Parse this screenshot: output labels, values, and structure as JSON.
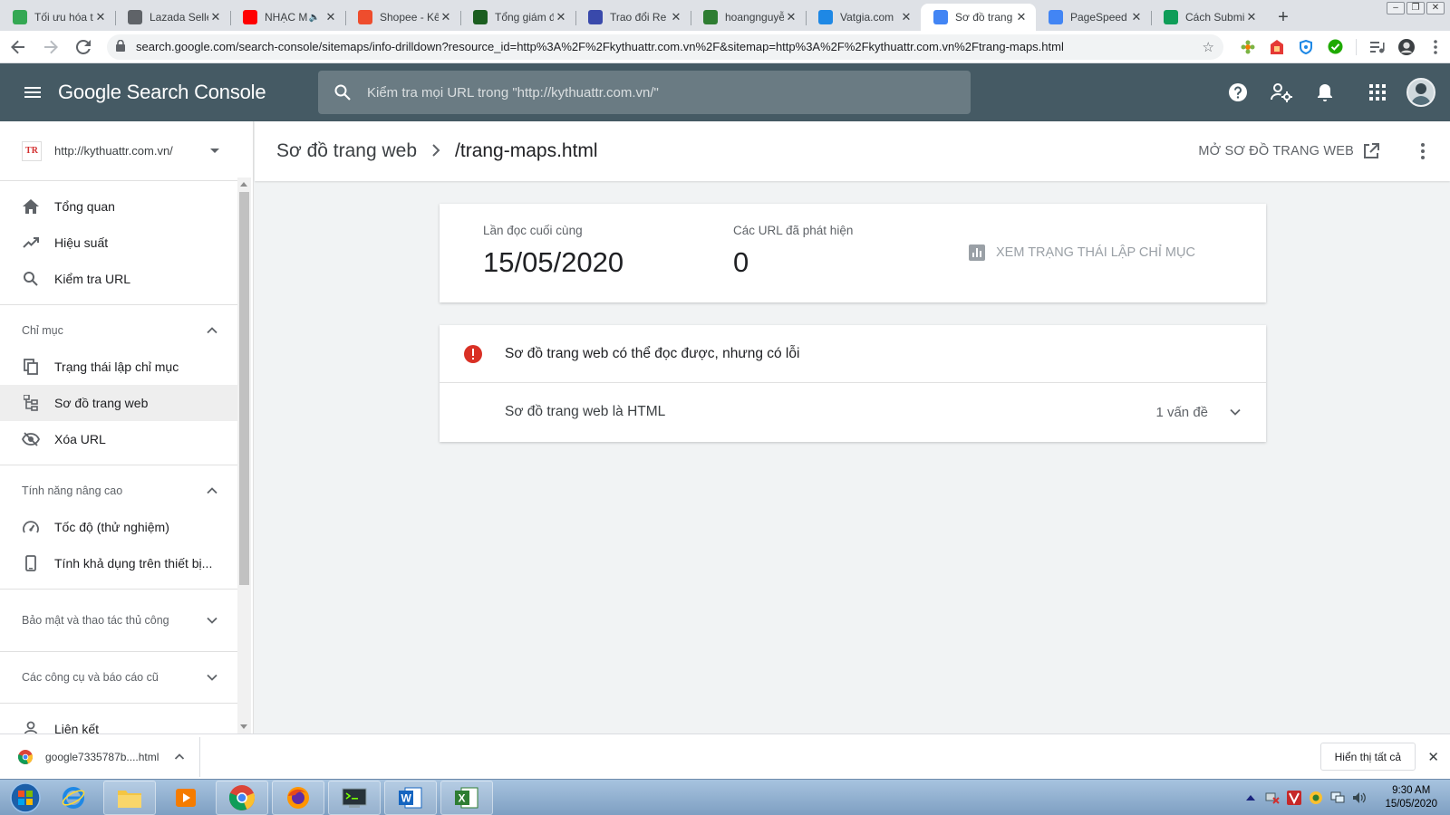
{
  "browser": {
    "tabs": [
      {
        "title": "Tối ưu hóa t",
        "icon": "green-app-icon",
        "color": "#34a853",
        "muted": false
      },
      {
        "title": "Lazada Selle",
        "icon": "globe-icon",
        "color": "#5f6368",
        "muted": false
      },
      {
        "title": "NHẠC M",
        "icon": "youtube-icon",
        "color": "#ff0000",
        "muted": true
      },
      {
        "title": "Shopee - Kê",
        "icon": "shopee-icon",
        "color": "#ee4d2d",
        "muted": false
      },
      {
        "title": "Tổng giám đ",
        "icon": "d-square-icon",
        "color": "#1b5e20",
        "muted": false
      },
      {
        "title": "Trao đổi Re",
        "icon": "forum-icon",
        "color": "#3949ab",
        "muted": false
      },
      {
        "title": "hoangnguyễ",
        "icon": "leaf-icon",
        "color": "#2e7d32",
        "muted": false
      },
      {
        "title": "Vatgia.com",
        "icon": "vatgia-icon",
        "color": "#1e88e5",
        "muted": false
      },
      {
        "title": "Sơ đồ trang",
        "icon": "search-console-icon",
        "color": "#4285f4",
        "muted": false,
        "active": true
      },
      {
        "title": "PageSpeed",
        "icon": "pagespeed-icon",
        "color": "#4285f4",
        "muted": false
      },
      {
        "title": "Cách Submi",
        "icon": "x-green-icon",
        "color": "#0f9d58",
        "muted": false
      }
    ],
    "url": "search.google.com/search-console/sitemaps/info-drilldown?resource_id=http%3A%2F%2Fkythuattr.com.vn%2F&sitemap=http%3A%2F%2Fkythuattr.com.vn%2Ftrang-maps.html"
  },
  "header": {
    "brand": "Google Search Console",
    "search_placeholder": "Kiểm tra mọi URL trong \"http://kythuattr.com.vn/\""
  },
  "sidebar": {
    "property_logo": "TR",
    "property_name": "http://kythuattr.com.vn/",
    "top_items": [
      {
        "label": "Tổng quan"
      },
      {
        "label": "Hiệu suất"
      },
      {
        "label": "Kiểm tra URL"
      }
    ],
    "section_index": {
      "title": "Chỉ mục",
      "items": [
        {
          "label": "Trạng thái lập chỉ mục"
        },
        {
          "label": "Sơ đồ trang web",
          "active": true
        },
        {
          "label": "Xóa URL"
        }
      ]
    },
    "section_advanced": {
      "title": "Tính năng nâng cao",
      "items": [
        {
          "label": "Tốc độ (thử nghiệm)"
        },
        {
          "label": "Tính khả dụng trên thiết bị..."
        }
      ]
    },
    "section_security": {
      "title": "Bảo mật và thao tác thủ công"
    },
    "section_legacy": {
      "title": "Các công cụ và báo cáo cũ"
    },
    "links_item": {
      "label": "Liên kết"
    }
  },
  "page": {
    "breadcrumb_root": "Sơ đồ trang web",
    "breadcrumb_current": "/trang-maps.html",
    "open_sitemap": "MỞ SƠ ĐỒ TRANG WEB"
  },
  "stats": {
    "last_read_label": "Lần đọc cuối cùng",
    "last_read_value": "15/05/2020",
    "discovered_label": "Các URL đã phát hiện",
    "discovered_value": "0",
    "index_status_link": "XEM TRẠNG THÁI LẬP CHỈ MỤC"
  },
  "issues": {
    "title": "Sơ đồ trang web có thể đọc được, nhưng có lỗi",
    "row_label": "Sơ đồ trang web là HTML",
    "row_count": "1 vấn đề"
  },
  "download_bar": {
    "file": "google7335787b....html",
    "show_all": "Hiển thị tất cả"
  },
  "taskbar": {
    "time": "9:30 AM",
    "date": "15/05/2020"
  },
  "colors": {
    "header_bg": "#455a64",
    "error_red": "#d93025",
    "active_nav_bg": "#eeeeee"
  }
}
